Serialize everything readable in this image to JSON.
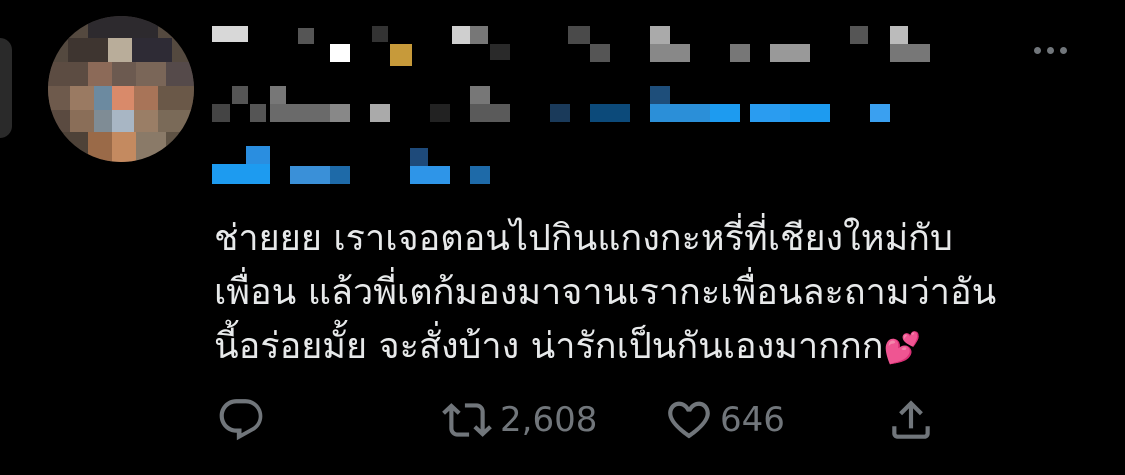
{
  "tweet": {
    "text_lines": [
      "ช่ายยย เราเจอตอนไปกินแกงกะหรี่ที่เชียงใหม่กับ",
      "เพื่อน แล้วพี่เตก้มองมาจานเรากะเพื่อนละถามว่าอัน",
      "นี้อร่อยมั้ย จะสั่งบ้าง น่ารักเป็นกันเองมากกก"
    ],
    "emoji": "💕"
  },
  "actions": {
    "reply_icon": "reply-icon",
    "retweet_icon": "retweet-icon",
    "retweet_count": "2,608",
    "like_icon": "heart-icon",
    "like_count": "646",
    "share_icon": "share-icon"
  },
  "colors": {
    "background": "#000000",
    "text": "#e7e9ea",
    "muted": "#71767b",
    "link_blue": "#1d9bf0"
  }
}
